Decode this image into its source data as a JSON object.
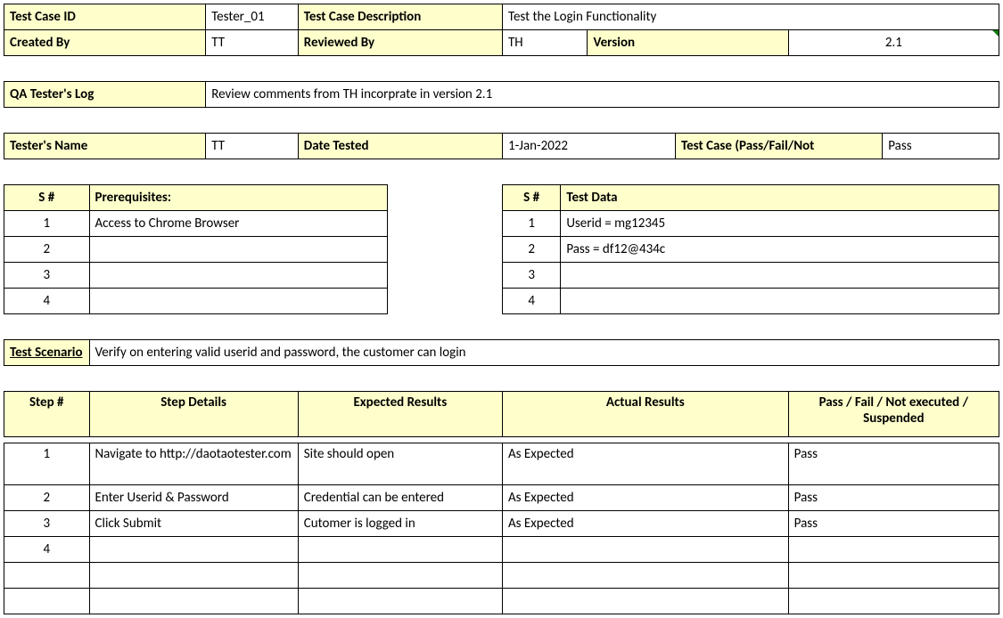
{
  "header": {
    "test_case_id_label": "Test Case ID",
    "test_case_id": "Tester_01",
    "test_case_desc_label": "Test Case Description",
    "test_case_desc": "Test the Login Functionality",
    "created_by_label": "Created By",
    "created_by": "TT",
    "reviewed_by_label": "Reviewed By",
    "reviewed_by": "TH",
    "version_label": "Version",
    "version": "2.1"
  },
  "qa_log": {
    "label": "QA Tester's Log",
    "value": "Review comments from TH incorprate in version 2.1"
  },
  "tester": {
    "name_label": "Tester's Name",
    "name": "TT",
    "date_tested_label": "Date Tested",
    "date_tested": "1-Jan-2022",
    "result_label": "Test Case (Pass/Fail/Not",
    "result": "Pass"
  },
  "prereq": {
    "s_label": "S #",
    "label": "Prerequisites:",
    "rows": [
      "Access to Chrome Browser",
      "",
      "",
      ""
    ],
    "nums": [
      "1",
      "2",
      "3",
      "4"
    ]
  },
  "testdata": {
    "s_label": "S #",
    "label": "Test Data",
    "rows": [
      "Userid = mg12345",
      "Pass = df12@434c",
      "",
      ""
    ],
    "nums": [
      "1",
      "2",
      "3",
      "4"
    ]
  },
  "scenario": {
    "label": "Test Scenario",
    "value": "Verify on entering valid userid and password, the customer can login"
  },
  "steps": {
    "headers": {
      "step": "Step #",
      "details": "Step Details",
      "expected": "Expected Results",
      "actual": "Actual Results",
      "passfail": "Pass / Fail / Not executed / Suspended"
    },
    "rows": [
      {
        "num": "1",
        "details": "Navigate to http://daotaotester.com",
        "expected": "Site should open",
        "actual": "As Expected",
        "pass": "Pass"
      },
      {
        "num": "2",
        "details": "Enter Userid & Password",
        "expected": "Credential can be entered",
        "actual": "As Expected",
        "pass": "Pass"
      },
      {
        "num": "3",
        "details": "Click Submit",
        "expected": "Cutomer is logged in",
        "actual": "As Expected",
        "pass": "Pass"
      },
      {
        "num": "4",
        "details": "",
        "expected": "",
        "actual": "",
        "pass": ""
      },
      {
        "num": "",
        "details": "",
        "expected": "",
        "actual": "",
        "pass": ""
      },
      {
        "num": "",
        "details": "",
        "expected": "",
        "actual": "",
        "pass": ""
      }
    ]
  }
}
